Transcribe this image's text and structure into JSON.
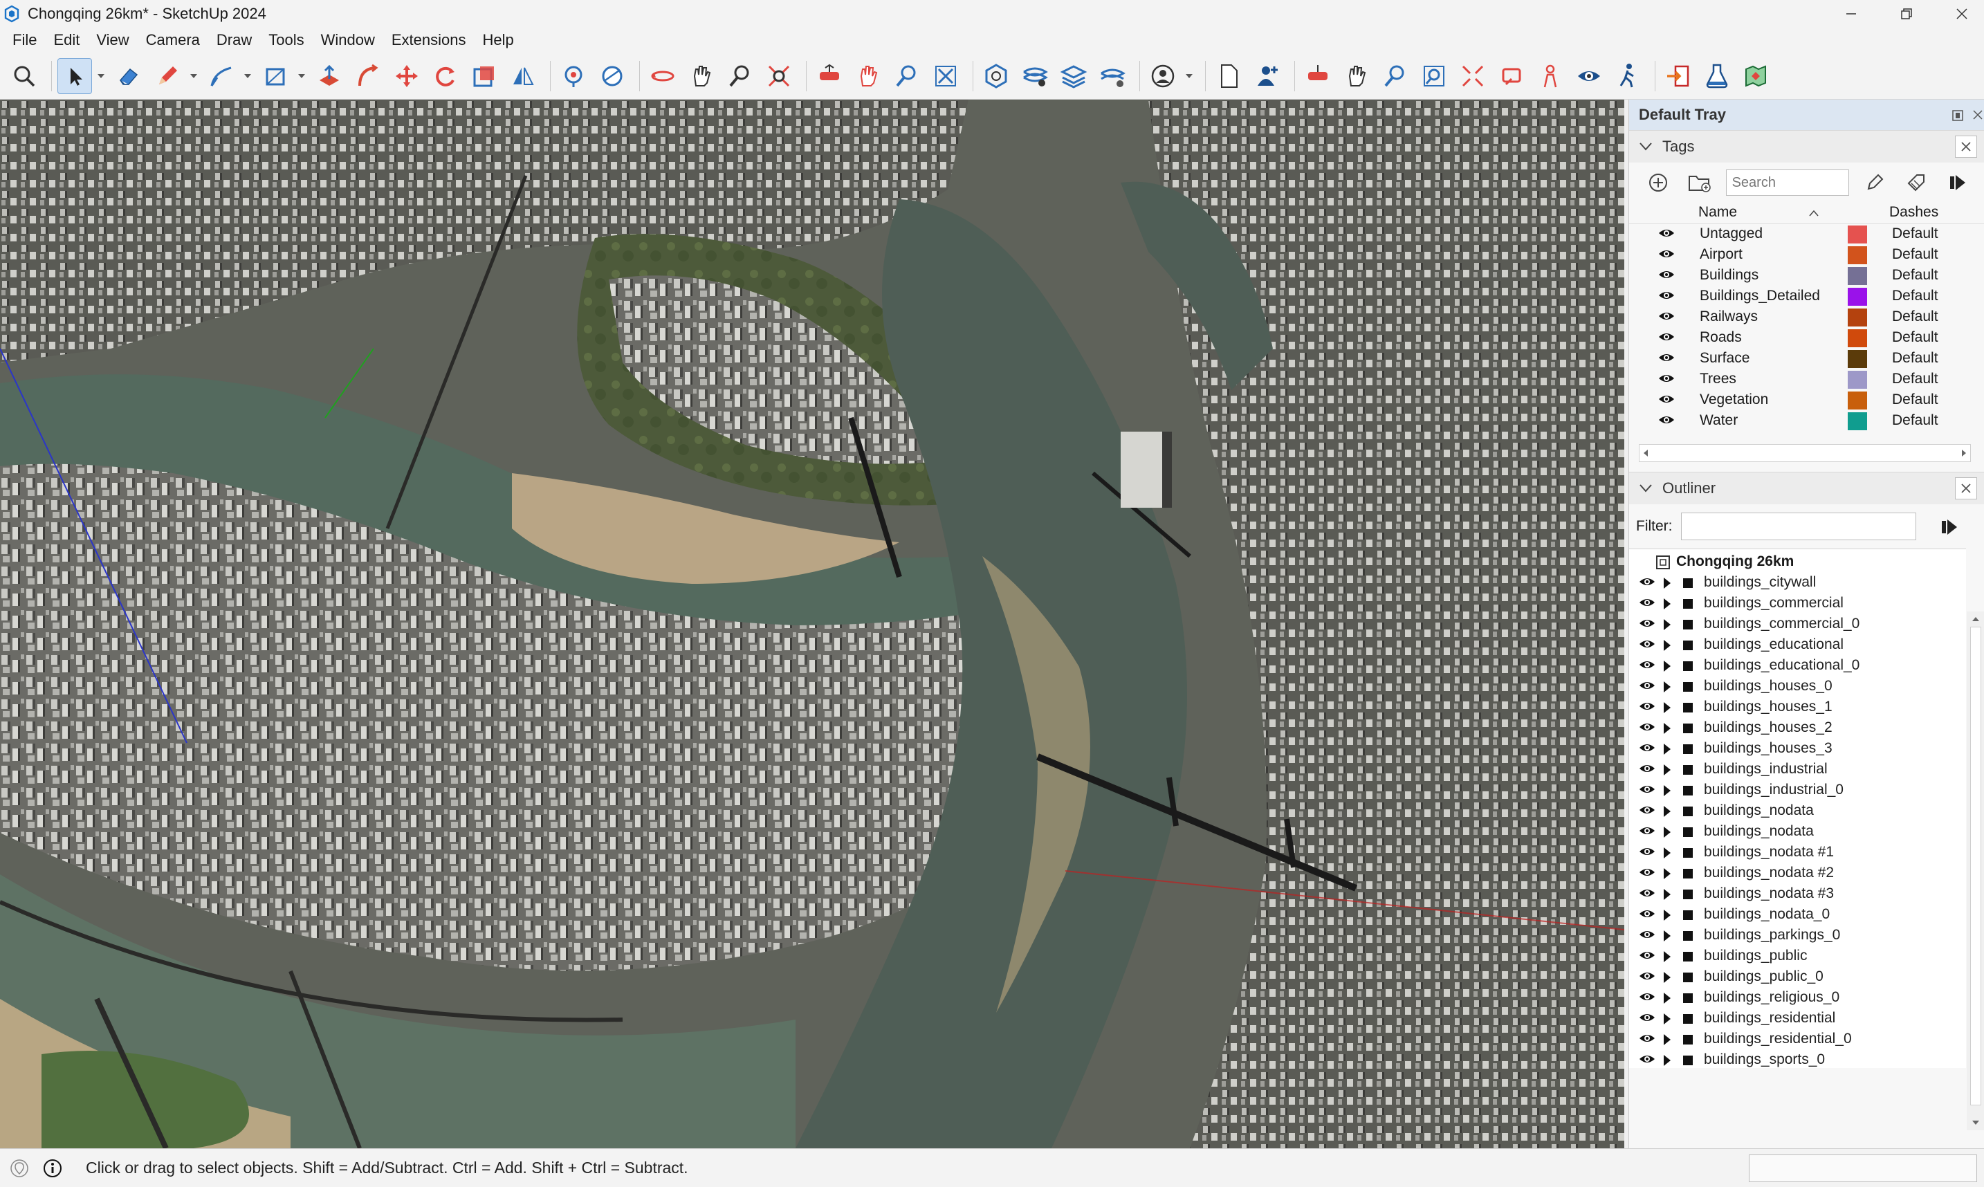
{
  "window": {
    "title": "Chongqing 26km* - SketchUp 2024",
    "app_icon": "sketchup-logo-icon",
    "controls": [
      "minimize-icon",
      "maximize-icon",
      "close-icon"
    ]
  },
  "menubar": {
    "items": [
      "File",
      "Edit",
      "View",
      "Camera",
      "Draw",
      "Tools",
      "Window",
      "Extensions",
      "Help"
    ]
  },
  "toolbar": {
    "tools": [
      "search-icon",
      "select-arrow-icon",
      "eraser-icon",
      "pencil-icon",
      "line-icon",
      "rectangle-icon",
      "push-pull-icon",
      "follow-me-icon",
      "move-icon",
      "rotate-icon",
      "scale-icon",
      "flip-icon",
      "paint-bucket-icon",
      "eraser-sphere-icon",
      "orbit-icon",
      "pan-icon",
      "zoom-icon",
      "zoom-extents-icon",
      "section-plane-icon",
      "sandbox-icon",
      "layers-icon",
      "solid-tools-icon",
      "user-account-icon",
      "new-file-icon",
      "add-user-icon",
      "orbit-2-icon",
      "pan-2-icon",
      "zoom-2-icon",
      "zoom-window-icon",
      "zoom-extents-2-icon",
      "previous-view-icon",
      "position-camera-icon",
      "look-around-icon",
      "walk-icon",
      "export-icon",
      "extension-warehouse-icon",
      "map-location-icon"
    ],
    "active_tool": "select-arrow-icon"
  },
  "tray": {
    "title": "Default Tray",
    "tags": {
      "title": "Tags",
      "search_placeholder": "Search",
      "col_name": "Name",
      "col_dashes": "Dashes",
      "rows": [
        {
          "name": "Untagged",
          "color": "#e5524f",
          "dashes": "Default"
        },
        {
          "name": "Airport",
          "color": "#d2531c",
          "dashes": "Default"
        },
        {
          "name": "Buildings",
          "color": "#757095",
          "dashes": "Default"
        },
        {
          "name": "Buildings_Detailed",
          "color": "#9a12ea",
          "dashes": "Default"
        },
        {
          "name": "Railways",
          "color": "#b4420e",
          "dashes": "Default"
        },
        {
          "name": "Roads",
          "color": "#d04a0c",
          "dashes": "Default"
        },
        {
          "name": "Surface",
          "color": "#5b3b0a",
          "dashes": "Default"
        },
        {
          "name": "Trees",
          "color": "#9d98c8",
          "dashes": "Default"
        },
        {
          "name": "Vegetation",
          "color": "#c85f0c",
          "dashes": "Default"
        },
        {
          "name": "Water",
          "color": "#109d8f",
          "dashes": "Default"
        }
      ]
    },
    "outliner": {
      "title": "Outliner",
      "filter_label": "Filter:",
      "root": "Chongqing 26km",
      "items": [
        "buildings_citywall",
        "buildings_commercial",
        "buildings_commercial_0",
        "buildings_educational",
        "buildings_educational_0",
        "buildings_houses_0",
        "buildings_houses_1",
        "buildings_houses_2",
        "buildings_houses_3",
        "buildings_industrial",
        "buildings_industrial_0",
        "buildings_nodata",
        "buildings_nodata",
        "buildings_nodata #1",
        "buildings_nodata #2",
        "buildings_nodata #3",
        "buildings_nodata_0",
        "buildings_parkings_0",
        "buildings_public",
        "buildings_public_0",
        "buildings_religious_0",
        "buildings_residential",
        "buildings_residential_0",
        "buildings_sports_0"
      ]
    }
  },
  "statusbar": {
    "text": "Click or drag to select objects. Shift = Add/Subtract. Ctrl = Add. Shift + Ctrl = Subtract.",
    "icons": [
      "geo-location-icon",
      "info-icon"
    ]
  }
}
